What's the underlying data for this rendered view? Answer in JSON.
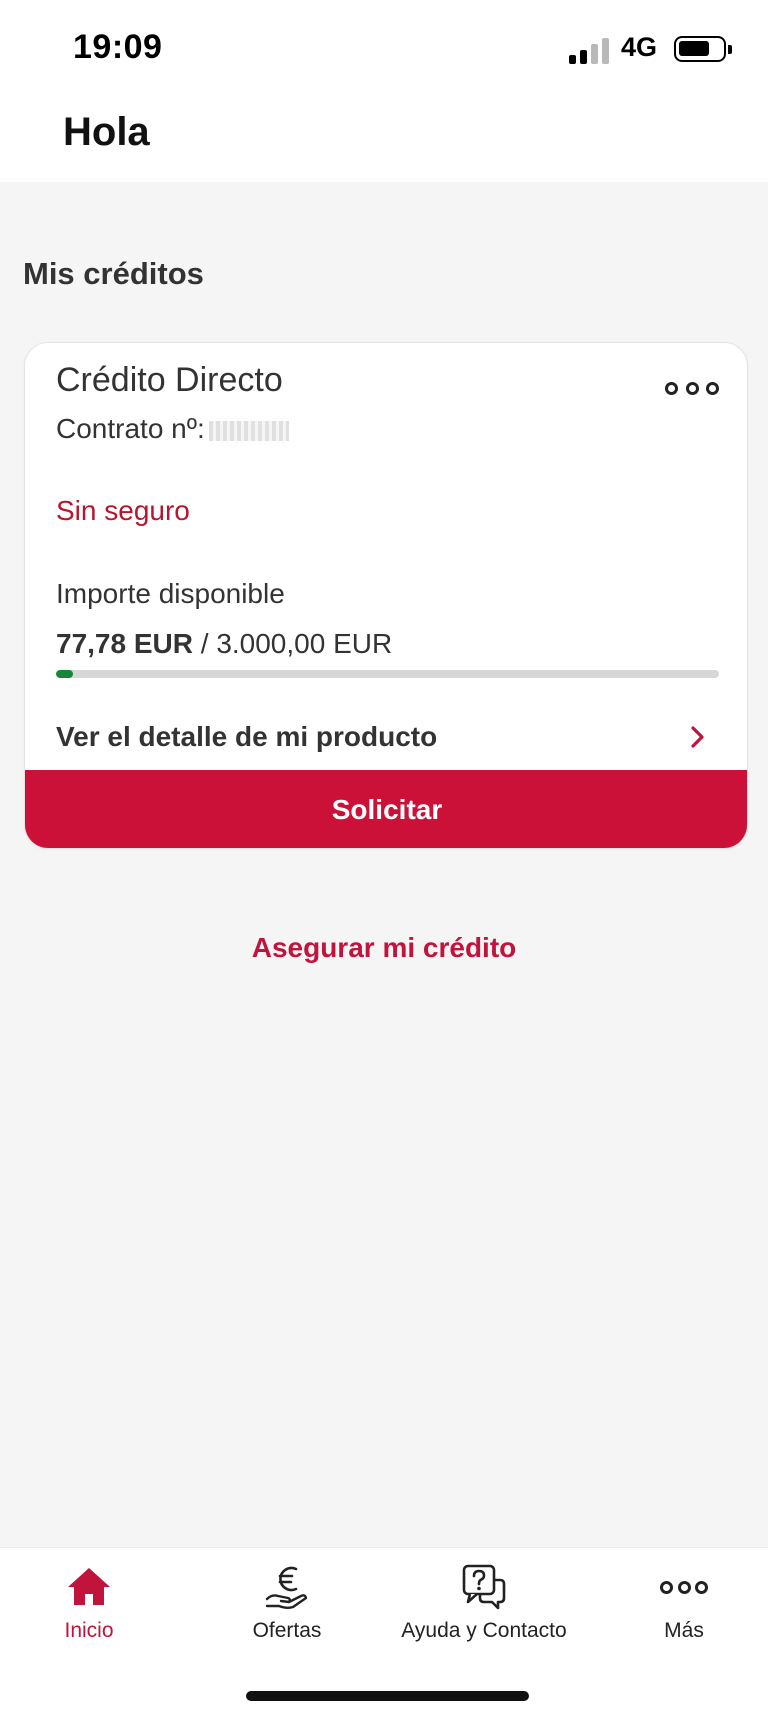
{
  "status_bar": {
    "time": "19:09",
    "network": "4G",
    "signal_icon": "signal-icon",
    "battery_icon": "battery-icon"
  },
  "header": {
    "greeting": "Hola"
  },
  "section": {
    "title": "Mis créditos"
  },
  "credit_card": {
    "title": "Crédito Directo",
    "contract_label": "Contrato nº:",
    "insurance_status": "Sin seguro",
    "available_label": "Importe disponible",
    "available_amount": "77,78 EUR",
    "separator": " / ",
    "total_amount": "3.000,00 EUR",
    "progress_fraction": 0.026,
    "detail_link_label": "Ver el detalle de mi producto",
    "apply_button_label": "Solicitar",
    "more_icon": "more-options-icon",
    "chevron_icon": "chevron-right-icon"
  },
  "secure_link": {
    "label": "Asegurar mi crédito"
  },
  "bottom_nav": {
    "items": [
      {
        "label": "Inicio",
        "icon": "home-icon",
        "active": true
      },
      {
        "label": "Ofertas",
        "icon": "euro-hand-icon",
        "active": false
      },
      {
        "label": "Ayuda y Contacto",
        "icon": "help-chat-icon",
        "active": false
      },
      {
        "label": "Más",
        "icon": "more-icon",
        "active": false
      }
    ]
  },
  "colors": {
    "accent": "#cc1138",
    "progress": "#17853a",
    "track": "#d7d7d7",
    "background": "#f5f5f5"
  }
}
